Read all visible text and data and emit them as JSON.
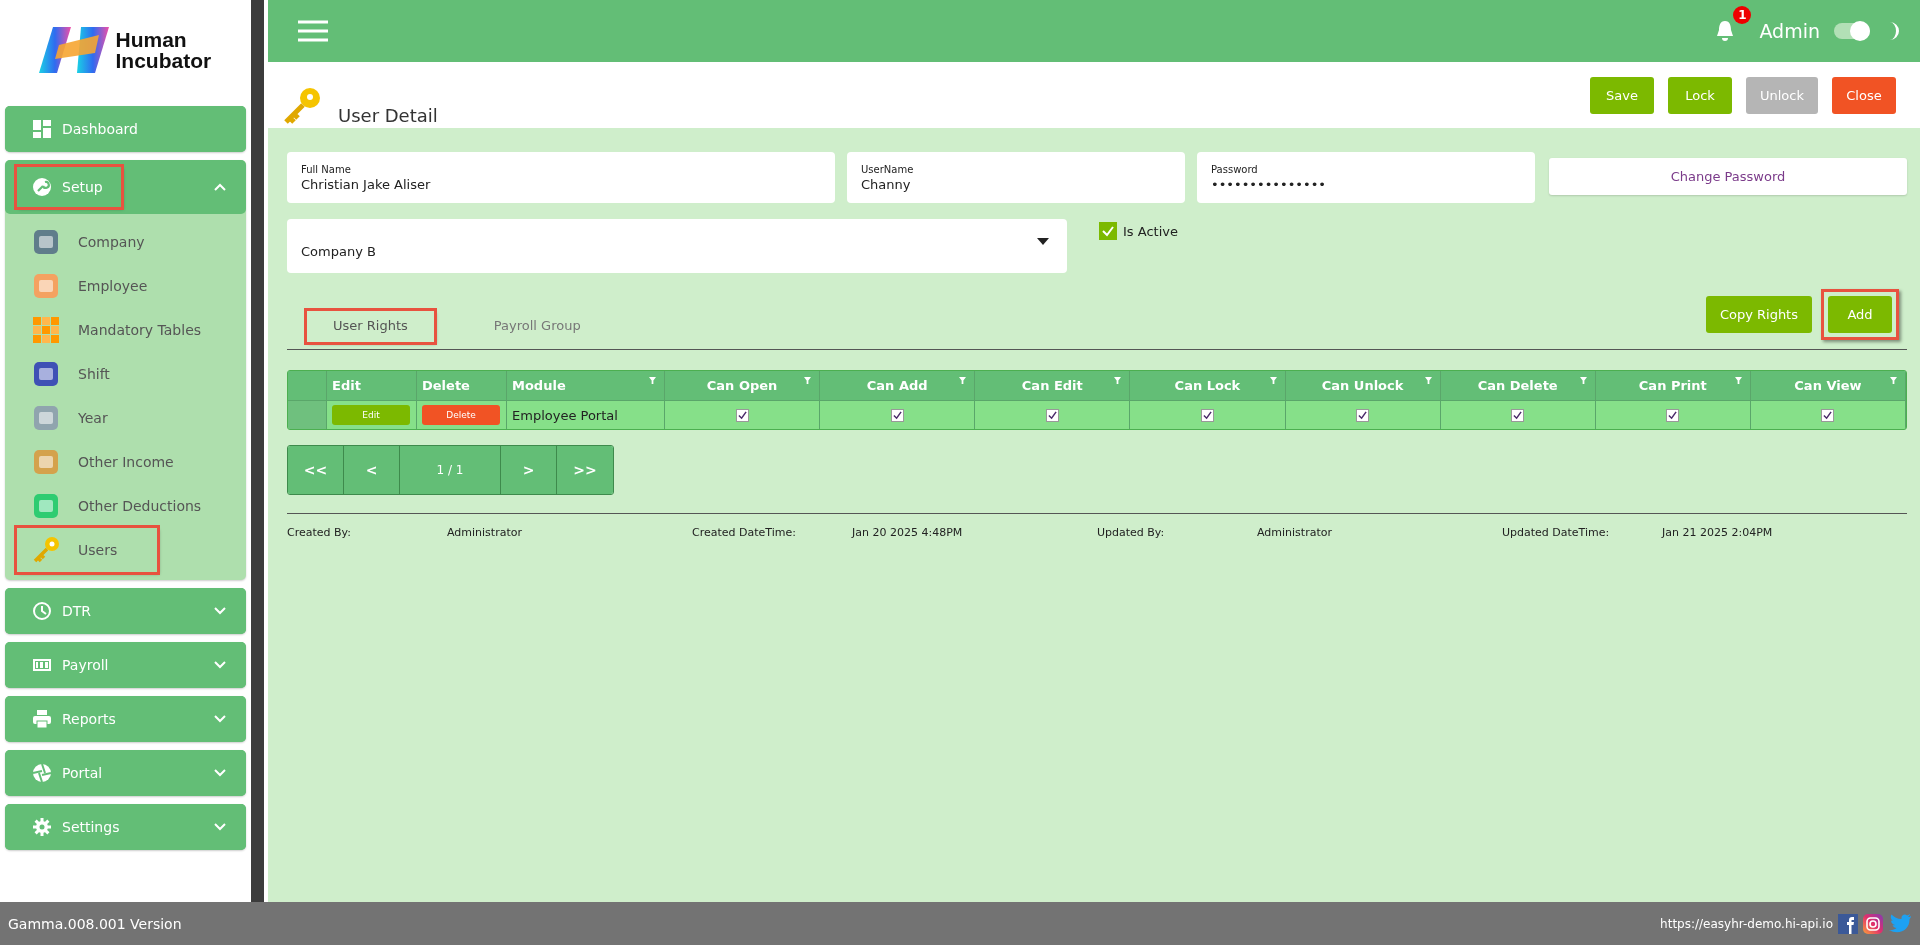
{
  "brand": {
    "line_1": "Human",
    "line_2": "Incubator"
  },
  "sidebar": {
    "items": [
      {
        "label": "Dashboard",
        "expandable": false,
        "expanded": false,
        "highlighted": false
      },
      {
        "label": "Setup",
        "expandable": true,
        "expanded": true,
        "highlighted": true,
        "children": [
          {
            "label": "Company",
            "highlighted": false
          },
          {
            "label": "Employee",
            "highlighted": false
          },
          {
            "label": "Mandatory Tables",
            "highlighted": false
          },
          {
            "label": "Shift",
            "highlighted": false
          },
          {
            "label": "Year",
            "highlighted": false
          },
          {
            "label": "Other Income",
            "highlighted": false
          },
          {
            "label": "Other Deductions",
            "highlighted": false
          },
          {
            "label": "Users",
            "highlighted": true
          }
        ]
      },
      {
        "label": "DTR",
        "expandable": true,
        "expanded": false,
        "highlighted": false
      },
      {
        "label": "Payroll",
        "expandable": true,
        "expanded": false,
        "highlighted": false
      },
      {
        "label": "Reports",
        "expandable": true,
        "expanded": false,
        "highlighted": false
      },
      {
        "label": "Portal",
        "expandable": true,
        "expanded": false,
        "highlighted": false
      },
      {
        "label": "Settings",
        "expandable": true,
        "expanded": false,
        "highlighted": false
      }
    ]
  },
  "topbar": {
    "notification_count": "1",
    "user": "Admin",
    "theme_toggle_on": true
  },
  "page": {
    "title": "User Detail",
    "actions": [
      {
        "label": "Save",
        "kind": "primary",
        "disabled": false
      },
      {
        "label": "Lock",
        "kind": "primary",
        "disabled": false
      },
      {
        "label": "Unlock",
        "kind": "primary",
        "disabled": true
      },
      {
        "label": "Close",
        "kind": "danger",
        "disabled": false
      }
    ]
  },
  "form": {
    "full_name": {
      "label": "Full Name",
      "value": "Christian Jake Aliser"
    },
    "username": {
      "label": "UserName",
      "value": "Channy"
    },
    "password": {
      "label": "Password",
      "value": "•••••••••••••••"
    },
    "change_password": "Change Password",
    "company": "Company B",
    "is_active": {
      "label": "Is Active",
      "checked": true
    }
  },
  "tabs": [
    {
      "label": "User Rights",
      "selected": true,
      "highlighted": true
    },
    {
      "label": "Payroll Group",
      "selected": false,
      "highlighted": false
    }
  ],
  "tab_actions": [
    {
      "label": "Copy Rights"
    },
    {
      "label": "Add",
      "highlighted": true
    }
  ],
  "table": {
    "columns": [
      "Edit",
      "Delete",
      "Module",
      "Can Open",
      "Can Add",
      "Can Edit",
      "Can Lock",
      "Can Unlock",
      "Can Delete",
      "Can Print",
      "Can View"
    ],
    "rows": [
      {
        "edit": "Edit",
        "delete": "Delete",
        "module": "Employee Portal",
        "rights": [
          {
            "checked": true
          },
          {
            "checked": true
          },
          {
            "checked": true
          },
          {
            "checked": true
          },
          {
            "checked": true
          },
          {
            "checked": true
          },
          {
            "checked": true
          },
          {
            "checked": true
          }
        ]
      }
    ]
  },
  "pagination": {
    "first": "<<",
    "prev": "<",
    "page": "1 / 1",
    "next": ">",
    "last": ">>"
  },
  "audit": [
    {
      "label": "Created By:",
      "value": "Administrator"
    },
    {
      "label": "Created DateTime:",
      "value": "Jan 20 2025 4:48PM"
    },
    {
      "label": "Updated By:",
      "value": "Administrator"
    },
    {
      "label": "Updated DateTime:",
      "value": "Jan 21 2025 2:04PM"
    }
  ],
  "footer": {
    "version": "Gamma.008.001 Version",
    "url": "https://easyhr-demo.hi-api.io"
  }
}
